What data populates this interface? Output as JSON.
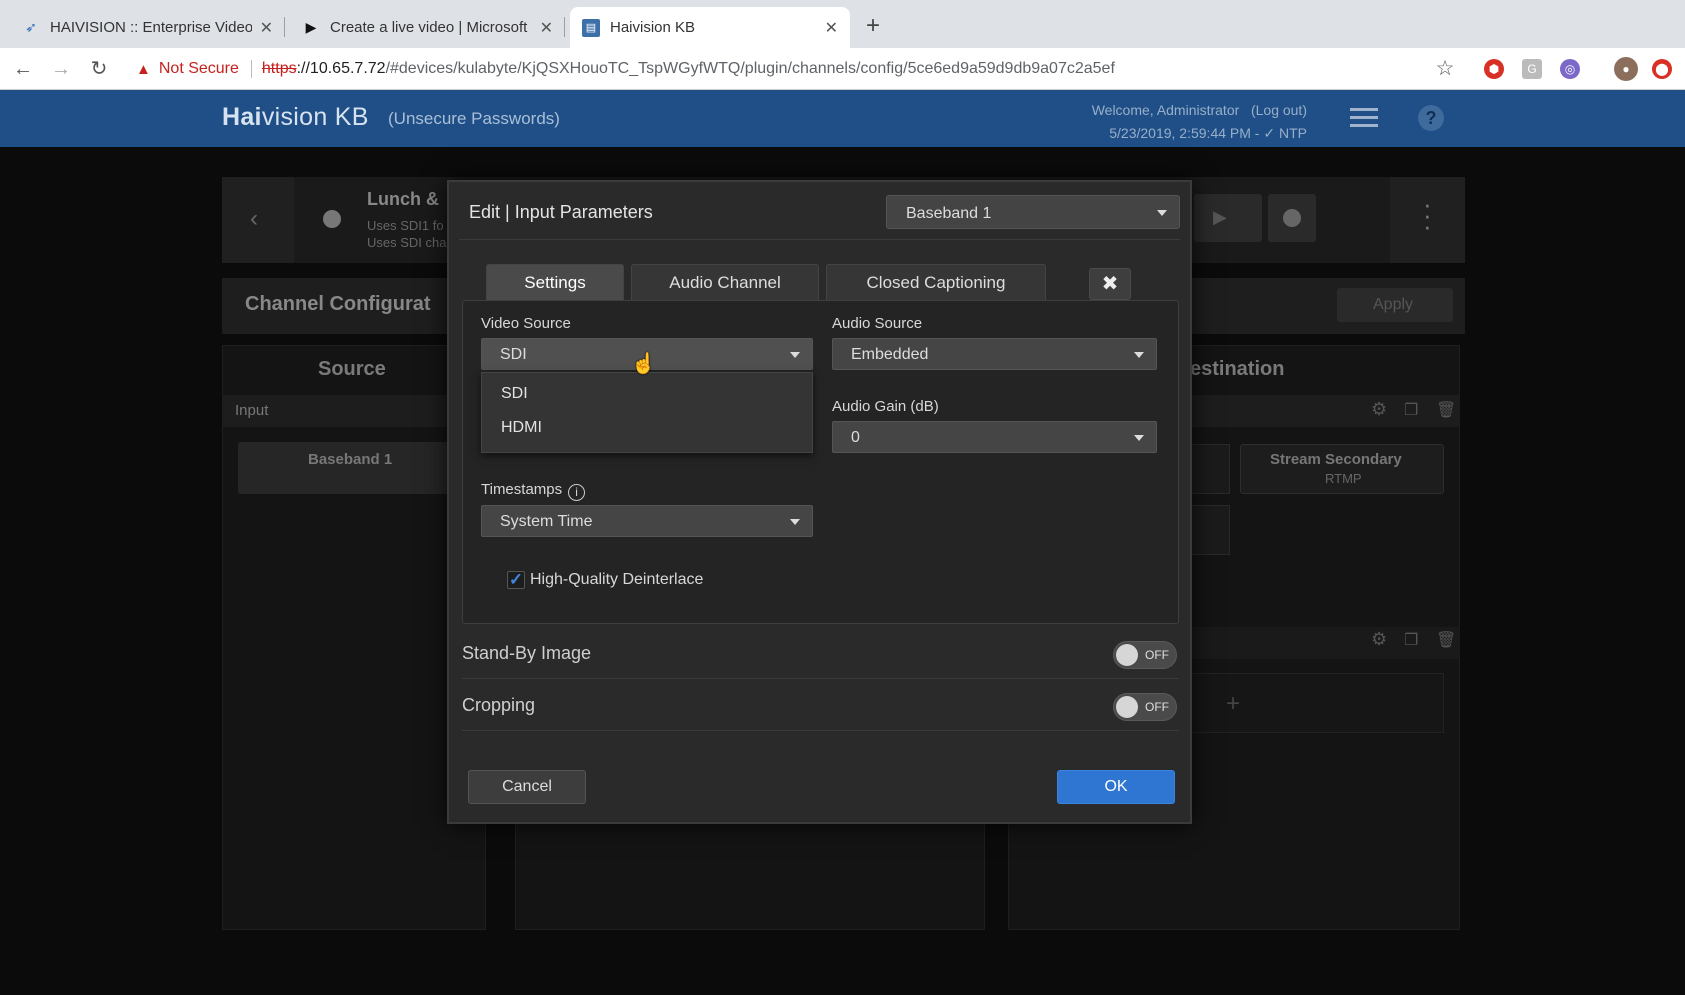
{
  "browser": {
    "tabs": [
      {
        "title": "HAIVISION :: Enterprise Video",
        "icon": "haivision-bird-icon"
      },
      {
        "title": "Create a live video | Microsoft",
        "icon": "play-triangle-icon"
      },
      {
        "title": "Haivision KB",
        "icon": "kb-doc-icon"
      }
    ],
    "new_tab": "+",
    "close": "✕",
    "security_label": "Not Secure",
    "url_scheme": "https",
    "url_host": "://10.65.7.72",
    "url_path": "/#devices/kulabyte/KjQSXHouoTC_TspWGyfWTQ/plugin/channels/config/5ce6ed9a59d9db9a07c2a5ef"
  },
  "app_header": {
    "brand_bold": "Hai",
    "brand_rest": "vision KB",
    "subtitle": "(Unsecure Passwords)",
    "welcome": "Welcome, Administrator",
    "logout": "(Log out)",
    "datetime": "5/23/2019, 2:59:44 PM",
    "ntp": "NTP",
    "help": "?"
  },
  "background": {
    "channel_name": "Lunch &",
    "channel_desc_1": "Uses SDI1 fo",
    "channel_desc_2": "Uses SDI cha",
    "config_title": "Channel Configurat",
    "apply": "Apply",
    "source_header": "Source",
    "destination_header": "estination",
    "input_label": "Input",
    "input_card": "Baseband 1",
    "dest_card_title": "Stream Secondary",
    "dest_card_sub": "RTMP",
    "add": "+"
  },
  "modal": {
    "title": "Edit | Input Parameters",
    "input_select": "Baseband 1",
    "tabs": {
      "settings": "Settings",
      "audio_channel": "Audio Channel",
      "closed_captioning": "Closed Captioning"
    },
    "video_source": {
      "label": "Video Source",
      "value": "SDI",
      "options": [
        "SDI",
        "HDMI"
      ]
    },
    "audio_source": {
      "label": "Audio Source",
      "value": "Embedded"
    },
    "audio_gain": {
      "label": "Audio Gain (dB)",
      "value": "0"
    },
    "timestamps": {
      "label": "Timestamps",
      "value": "System Time"
    },
    "deinterlace": {
      "label": "High-Quality Deinterlace",
      "checked": true
    },
    "standby": {
      "label": "Stand-By Image",
      "state": "OFF"
    },
    "cropping": {
      "label": "Cropping",
      "state": "OFF"
    },
    "cancel": "Cancel",
    "ok": "OK"
  },
  "colors": {
    "header": "#1f4f86",
    "primary_button": "#2f76d2",
    "modal_bg": "#2a2a2a"
  }
}
